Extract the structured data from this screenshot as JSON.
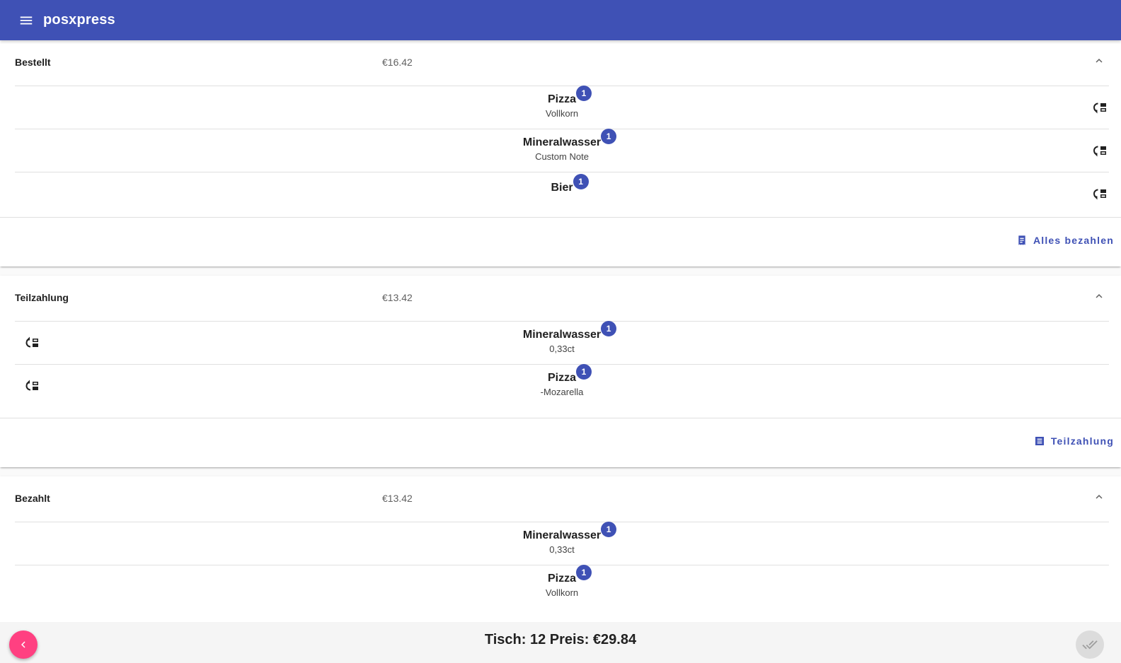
{
  "app": {
    "title": "posxpress",
    "menu_icon": "menu-icon"
  },
  "panels": {
    "ordered": {
      "title": "Bestellt",
      "price": "€16.42",
      "items": [
        {
          "name": "Pizza",
          "note": "Vollkorn",
          "count": "1"
        },
        {
          "name": "Mineralwasser",
          "note": "Custom Note",
          "count": "1"
        },
        {
          "name": "Bier",
          "note": "",
          "count": "1"
        }
      ],
      "action_label": "Alles bezahlen",
      "action_icon": "receipt-icon",
      "item_action_icon": "move-to-partial-icon"
    },
    "partial": {
      "title": "Teilzahlung",
      "price": "€13.42",
      "items": [
        {
          "name": "Mineralwasser",
          "note": "0,33ct",
          "count": "1"
        },
        {
          "name": "Pizza",
          "note": "-Mozarella",
          "count": "1"
        }
      ],
      "action_label": "Teilzahlung",
      "action_icon": "list-icon",
      "item_action_icon": "move-back-icon"
    },
    "paid": {
      "title": "Bezahlt",
      "price": "€13.42",
      "items": [
        {
          "name": "Mineralwasser",
          "note": "0,33ct",
          "count": "1"
        },
        {
          "name": "Pizza",
          "note": "Vollkorn",
          "count": "1"
        }
      ]
    }
  },
  "footer": {
    "total": "Tisch: 12 Preis: €29.84",
    "back_icon": "chevron-left-icon",
    "done_icon": "done-all-icon"
  },
  "colors": {
    "primary": "#3f51b5",
    "accent": "#ff4081"
  }
}
